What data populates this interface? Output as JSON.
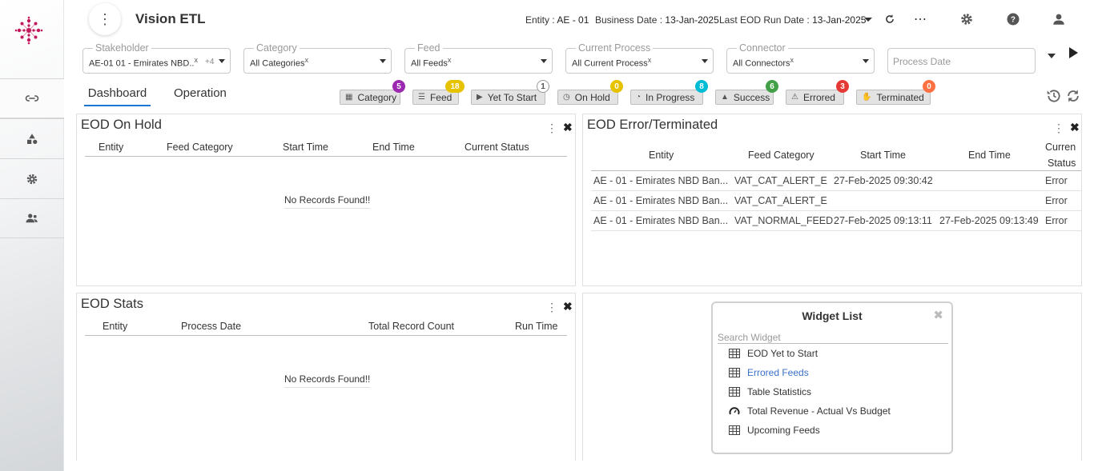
{
  "app": {
    "title": "Vision ETL"
  },
  "header": {
    "entity_label": "Entity :",
    "entity_value": "AE - 01",
    "business_date_label": "Business Date :",
    "business_date_value": "13-Jan-2025",
    "last_eod_label": "Last EOD Run Date :",
    "last_eod_value": "13-Jan-2025"
  },
  "filters": {
    "stakeholder": {
      "label": "Stakeholder",
      "value": "AE-01 01 - Emirates NBD..",
      "clear": "x",
      "more": "+4"
    },
    "category": {
      "label": "Category",
      "value": "All Categories",
      "clear": "x"
    },
    "feed": {
      "label": "Feed",
      "value": "All Feeds",
      "clear": "x"
    },
    "current_process": {
      "label": "Current Process",
      "value": "All Current Process",
      "clear": "x"
    },
    "connector": {
      "label": "Connector",
      "value": "All Connectors",
      "clear": "x"
    },
    "process_date": {
      "placeholder": "Process Date"
    }
  },
  "tabs": [
    {
      "label": "Dashboard",
      "active": true
    },
    {
      "label": "Operation",
      "active": false
    }
  ],
  "status_chips": [
    {
      "label": "Category",
      "count": "5",
      "color": "#9c27b0",
      "icon": "grid-icon"
    },
    {
      "label": "Feed",
      "count": "18",
      "color": "#e6c200",
      "icon": "list-icon"
    },
    {
      "label": "Yet To Start",
      "count": "1",
      "color": "#ffffff",
      "icon": "play-circle-icon"
    },
    {
      "label": "On Hold",
      "count": "0",
      "color": "#e6c200",
      "icon": "clock-icon"
    },
    {
      "label": "In Progress",
      "count": "8",
      "color": "#00bcd4",
      "icon": "pie-icon"
    },
    {
      "label": "Success",
      "count": "6",
      "color": "#43a047",
      "icon": "thumbs-up-icon"
    },
    {
      "label": "Errored",
      "count": "3",
      "color": "#e53935",
      "icon": "warning-icon"
    },
    {
      "label": "Terminated",
      "count": "0",
      "color": "#ff7043",
      "icon": "hand-icon"
    }
  ],
  "panels": {
    "eod_on_hold": {
      "title": "EOD On Hold",
      "columns": [
        "Entity",
        "Feed Category",
        "Start Time",
        "End Time",
        "Current Status"
      ],
      "empty_text": "No Records Found!!"
    },
    "eod_error": {
      "title": "EOD Error/Terminated",
      "columns": [
        "Entity",
        "Feed Category",
        "Start Time",
        "End Time",
        "Curren",
        "Status"
      ],
      "rows": [
        [
          "AE - 01 - Emirates NBD Ban...",
          "VAT_CAT_ALERT_E",
          "27-Feb-2025 09:30:42",
          "",
          "Error"
        ],
        [
          "AE - 01 - Emirates NBD Ban...",
          "VAT_CAT_ALERT_E",
          "",
          "",
          "Error"
        ],
        [
          "AE - 01 - Emirates NBD Ban...",
          "VAT_NORMAL_FEED",
          "27-Feb-2025 09:13:11",
          "27-Feb-2025 09:13:49",
          "Error"
        ]
      ]
    },
    "eod_stats": {
      "title": "EOD Stats",
      "columns": [
        "Entity",
        "Process Date",
        "Total Record Count",
        "Run Time"
      ],
      "empty_text": "No Records Found!!"
    }
  },
  "widget_list": {
    "title": "Widget List",
    "search_placeholder": "Search Widget",
    "items": [
      {
        "label": "EOD Yet to Start",
        "icon": "table-icon",
        "highlight": false
      },
      {
        "label": "Errored Feeds",
        "icon": "table-icon",
        "highlight": true
      },
      {
        "label": "Table Statistics",
        "icon": "table-icon",
        "highlight": false
      },
      {
        "label": "Total Revenue - Actual Vs Budget",
        "icon": "gauge-icon",
        "highlight": false
      },
      {
        "label": "Upcoming Feeds",
        "icon": "table-icon",
        "highlight": false
      }
    ]
  },
  "colors": {
    "accent": "#1976d2",
    "brand": "#c2185b",
    "link": "#3a6fc7"
  }
}
